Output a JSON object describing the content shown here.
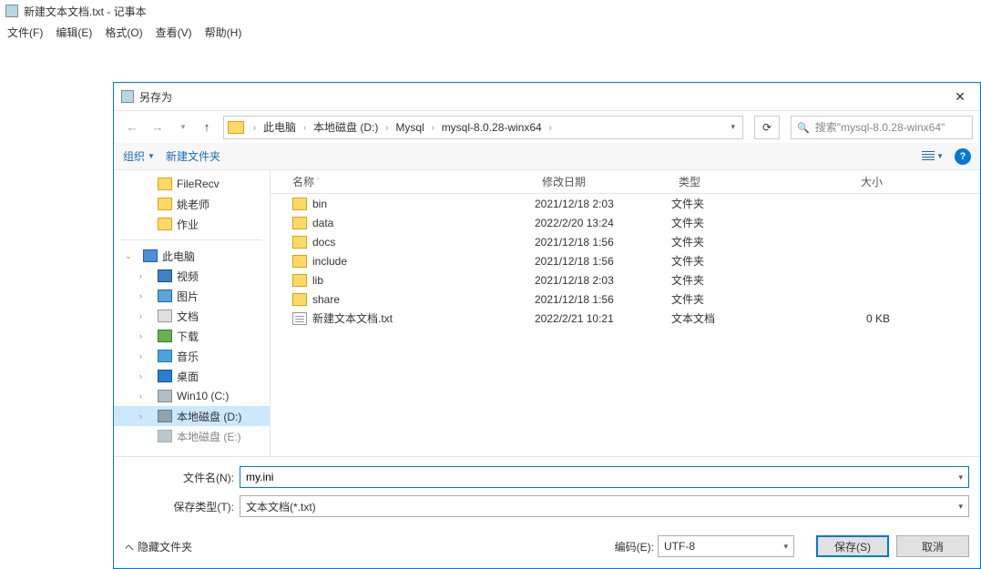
{
  "notepad": {
    "title": "新建文本文档.txt - 记事本",
    "menu": {
      "file": "文件(F)",
      "edit": "编辑(E)",
      "format": "格式(O)",
      "view": "查看(V)",
      "help": "帮助(H)"
    }
  },
  "dialog": {
    "title": "另存为",
    "breadcrumb": {
      "pc": "此电脑",
      "drive": "本地磁盘 (D:)",
      "d1": "Mysql",
      "d2": "mysql-8.0.28-winx64"
    },
    "search_placeholder": "搜索\"mysql-8.0.28-winx64\"",
    "toolbar": {
      "organize": "组织",
      "new_folder": "新建文件夹"
    },
    "tree": {
      "filerecv": "FileRecv",
      "yao": "姚老师",
      "zuoye": "作业",
      "this_pc": "此电脑",
      "video": "视频",
      "pics": "图片",
      "docs": "文档",
      "downloads": "下载",
      "music": "音乐",
      "desktop": "桌面",
      "win10c": "Win10 (C:)",
      "drive_d": "本地磁盘 (D:)",
      "drive_e": "本地磁盘 (E:)"
    },
    "columns": {
      "name": "名称",
      "modified": "修改日期",
      "type": "类型",
      "size": "大小"
    },
    "files": [
      {
        "name": "bin",
        "date": "2021/12/18 2:03",
        "type": "文件夹",
        "size": "",
        "kind": "folder"
      },
      {
        "name": "data",
        "date": "2022/2/20 13:24",
        "type": "文件夹",
        "size": "",
        "kind": "folder"
      },
      {
        "name": "docs",
        "date": "2021/12/18 1:56",
        "type": "文件夹",
        "size": "",
        "kind": "folder"
      },
      {
        "name": "include",
        "date": "2021/12/18 1:56",
        "type": "文件夹",
        "size": "",
        "kind": "folder"
      },
      {
        "name": "lib",
        "date": "2021/12/18 2:03",
        "type": "文件夹",
        "size": "",
        "kind": "folder"
      },
      {
        "name": "share",
        "date": "2021/12/18 1:56",
        "type": "文件夹",
        "size": "",
        "kind": "folder"
      },
      {
        "name": "新建文本文档.txt",
        "date": "2022/2/21 10:21",
        "type": "文本文档",
        "size": "0 KB",
        "kind": "txt"
      }
    ],
    "labels": {
      "filename": "文件名(N):",
      "filetype": "保存类型(T):",
      "encoding": "编码(E):",
      "hide_folders": "隐藏文件夹"
    },
    "filename_value": "my.ini",
    "filetype_value": "文本文档(*.txt)",
    "encoding_value": "UTF-8",
    "buttons": {
      "save": "保存(S)",
      "cancel": "取消"
    }
  }
}
